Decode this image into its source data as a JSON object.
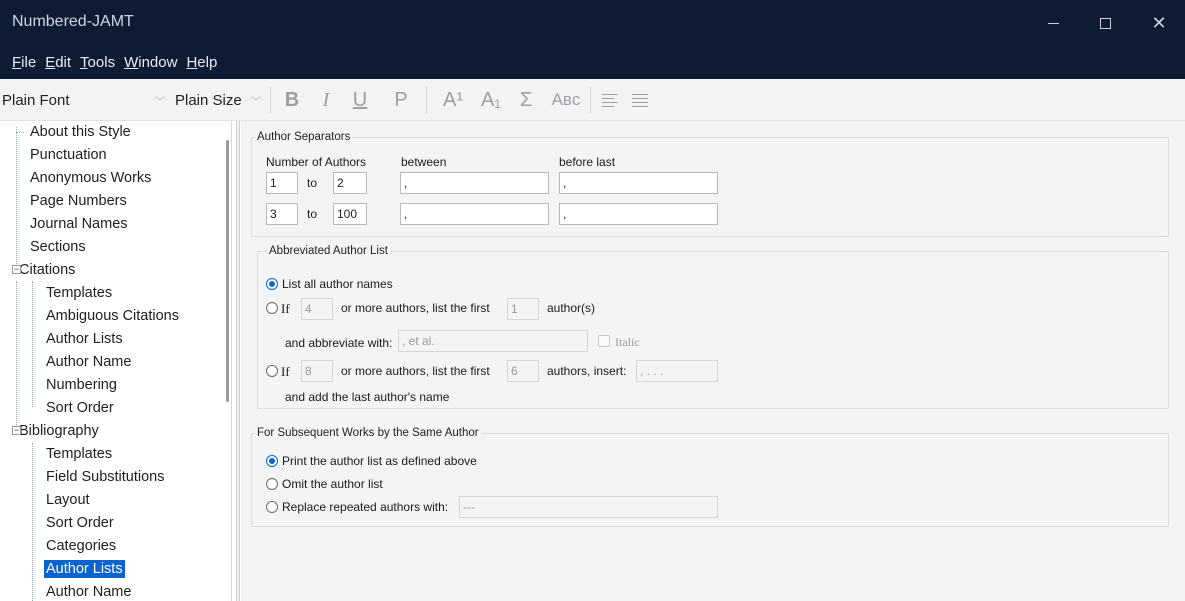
{
  "window": {
    "title": "Numbered-JAMT"
  },
  "menu": [
    {
      "label": "File",
      "key": "F",
      "rest": "ile"
    },
    {
      "label": "Edit",
      "key": "E",
      "rest": "dit"
    },
    {
      "label": "Tools",
      "key": "T",
      "rest": "ools"
    },
    {
      "label": "Window",
      "key": "W",
      "rest": "indow"
    },
    {
      "label": "Help",
      "key": "H",
      "rest": "elp"
    }
  ],
  "toolbar": {
    "font": "Plain Font",
    "size": "Plain Size",
    "bold": "B",
    "italic": "I",
    "underline": "U",
    "plain": "P",
    "superscript": "A¹",
    "subscript": "A₁",
    "symbol": "Σ",
    "smallcaps": "Aʙᴄ"
  },
  "tree": [
    {
      "label": "About this Style",
      "level": 0
    },
    {
      "label": "Punctuation",
      "level": 0
    },
    {
      "label": "Anonymous Works",
      "level": 0
    },
    {
      "label": "Page Numbers",
      "level": 0
    },
    {
      "label": "Journal Names",
      "level": 0
    },
    {
      "label": "Sections",
      "level": 0
    },
    {
      "label": "Citations",
      "level": 0,
      "expander": "⊟"
    },
    {
      "label": "Templates",
      "level": 1
    },
    {
      "label": "Ambiguous Citations",
      "level": 1
    },
    {
      "label": "Author Lists",
      "level": 1
    },
    {
      "label": "Author Name",
      "level": 1
    },
    {
      "label": "Numbering",
      "level": 1
    },
    {
      "label": "Sort Order",
      "level": 1
    },
    {
      "label": "Bibliography",
      "level": 0,
      "expander": "⊟"
    },
    {
      "label": "Templates",
      "level": 1
    },
    {
      "label": "Field Substitutions",
      "level": 1
    },
    {
      "label": "Layout",
      "level": 1
    },
    {
      "label": "Sort Order",
      "level": 1
    },
    {
      "label": "Categories",
      "level": 1
    },
    {
      "label": "Author Lists",
      "level": 1,
      "selected": true
    },
    {
      "label": "Author Name",
      "level": 1
    }
  ],
  "author_separators": {
    "title": "Author Separators",
    "col_number": "Number of Authors",
    "col_between": "between",
    "col_before_last": "before last",
    "to": "to",
    "rows": [
      {
        "from": "1",
        "to": "2",
        "between": ",",
        "before_last": ","
      },
      {
        "from": "3",
        "to": "100",
        "between": ",",
        "before_last": ","
      }
    ]
  },
  "abbreviated": {
    "title": "Abbreviated Author List",
    "list_all": "List all author names",
    "if_label": "If",
    "more_list_first": "or more authors, list the first",
    "authors_suffix": "author(s)",
    "opt1_min": "4",
    "opt1_first": "1",
    "abbreviate_with_label": "and abbreviate with:",
    "abbreviate_with": ", et al.",
    "italic": "Italic",
    "opt2_min": "8",
    "opt2_first": "6",
    "insert_label": "authors, insert:",
    "insert_value": ", . . .",
    "add_last": "and add the last author's name"
  },
  "subsequent": {
    "title": "For Subsequent Works by the Same Author",
    "print_list": "Print the author list as defined above",
    "omit_list": "Omit the author list",
    "replace_label": "Replace repeated authors with:",
    "replace_value": "---"
  }
}
